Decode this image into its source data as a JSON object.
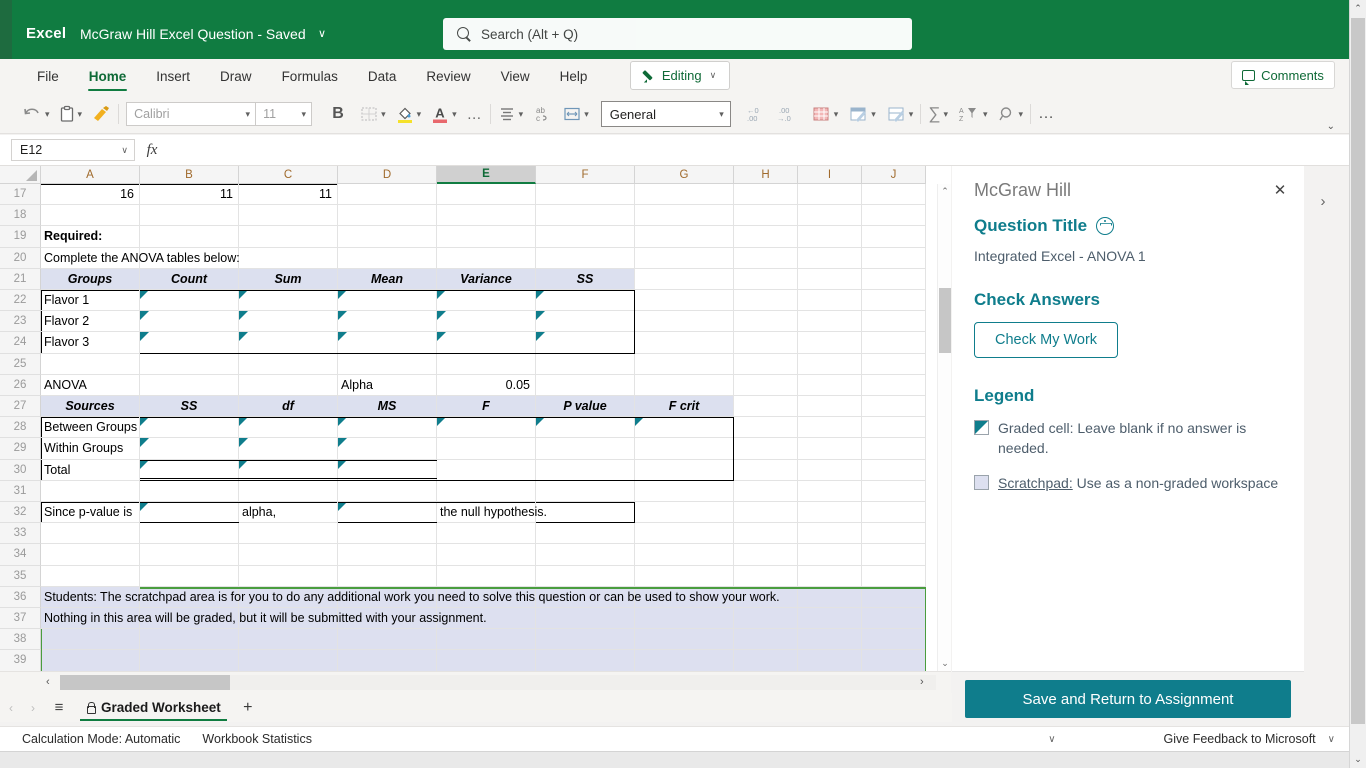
{
  "titlebar": {
    "app_name": "Excel",
    "document_title": "McGraw Hill Excel Question  -  Saved",
    "title_chevron": "∨",
    "search_placeholder": "Search (Alt + Q)"
  },
  "ribbon": {
    "tabs": [
      "File",
      "Home",
      "Insert",
      "Draw",
      "Formulas",
      "Data",
      "Review",
      "View",
      "Help"
    ],
    "active_tab": "Home",
    "editing_label": "Editing",
    "editing_chevron": "∨",
    "comments_label": "Comments",
    "collapse_chevron": "⌄"
  },
  "toolbar": {
    "undo": "↶",
    "paste": "ὌB",
    "format_painter": "✎",
    "font_name": "Calibri",
    "font_size": "11",
    "bold": "B",
    "borders": "borders",
    "fill_color": "A",
    "font_color": "A",
    "more": "…",
    "align": "≡",
    "wrap_text": "ab",
    "merge": "↔",
    "number_format": "General",
    "decrease_decimal": "←.0",
    "increase_decimal": ".00→",
    "conditional_formatting": "cf",
    "format_as_table": "table",
    "cell_styles": "styles",
    "autosum": "∑",
    "sort_filter": "A↓",
    "find": "⌕",
    "overflow": "…"
  },
  "formula_bar": {
    "name_box": "E12",
    "name_box_chevron": "∨",
    "fx": "fx",
    "formula_value": ""
  },
  "grid": {
    "columns": [
      "A",
      "B",
      "C",
      "D",
      "E",
      "F",
      "G",
      "H",
      "I",
      "J"
    ],
    "selected_column": "E",
    "rows": [
      17,
      18,
      19,
      20,
      21,
      22,
      23,
      24,
      25,
      26,
      27,
      28,
      29,
      30,
      31,
      32,
      33,
      34,
      35,
      36,
      37,
      38,
      39
    ],
    "cells": {
      "A17": "16",
      "B17": "11",
      "C17": "11",
      "A19": "Required:",
      "A20": "Complete the ANOVA tables below:",
      "A21": "Groups",
      "B21": "Count",
      "C21": "Sum",
      "D21": "Mean",
      "E21": "Variance",
      "F21": "SS",
      "A22": "Flavor 1",
      "A23": "Flavor 2",
      "A24": "Flavor 3",
      "A26": "ANOVA",
      "D26": "Alpha",
      "E26": "0.05",
      "A27": "Sources",
      "B27": "SS",
      "C27": "df",
      "D27": "MS",
      "E27": "F",
      "F27": "P value",
      "G27": "F crit",
      "A28": "Between Groups",
      "A29": "Within Groups",
      "A30": "Total",
      "A32": "Since p-value is",
      "C32": "alpha,",
      "E32": "the null hypothesis.",
      "A36": "Students: The scratchpad area is for you to do any additional work you need to solve this question or can be used to show your work.",
      "A37": "Nothing in this area will be graded, but it will be submitted with your assignment."
    },
    "scrollbar_up": "⌃",
    "scrollbar_down": "⌄",
    "hscroll_left": "‹",
    "hscroll_right": "›"
  },
  "sheetbar": {
    "prev": "‹",
    "next": "›",
    "all_sheets": "≡",
    "sheet_name": "Graded Worksheet",
    "add_sheet": "+"
  },
  "statusbar": {
    "calculation_mode": "Calculation Mode: Automatic",
    "workbook_statistics": "Workbook Statistics",
    "feedback": "Give Feedback to Microsoft",
    "chevron": "∨",
    "right_chevron": "∨"
  },
  "pane": {
    "title": "McGraw Hill",
    "close": "✕",
    "expand": "›",
    "question_heading": "Question Title",
    "question_text": "Integrated Excel - ANOVA 1",
    "check_heading": "Check Answers",
    "check_button": "Check My Work",
    "legend_heading": "Legend",
    "legend_graded": "Graded cell: Leave blank if no answer is needed.",
    "legend_scratchpad_link": "Scratchpad:",
    "legend_scratchpad_rest": " Use as a non-graded workspace",
    "save_button": "Save and Return to Assignment"
  },
  "colors": {
    "excel_green": "#107c41",
    "mcgraw_teal": "#0f7d8c",
    "header_fill": "#dce0ef",
    "scratchpad_fill": "#dde0f0"
  }
}
